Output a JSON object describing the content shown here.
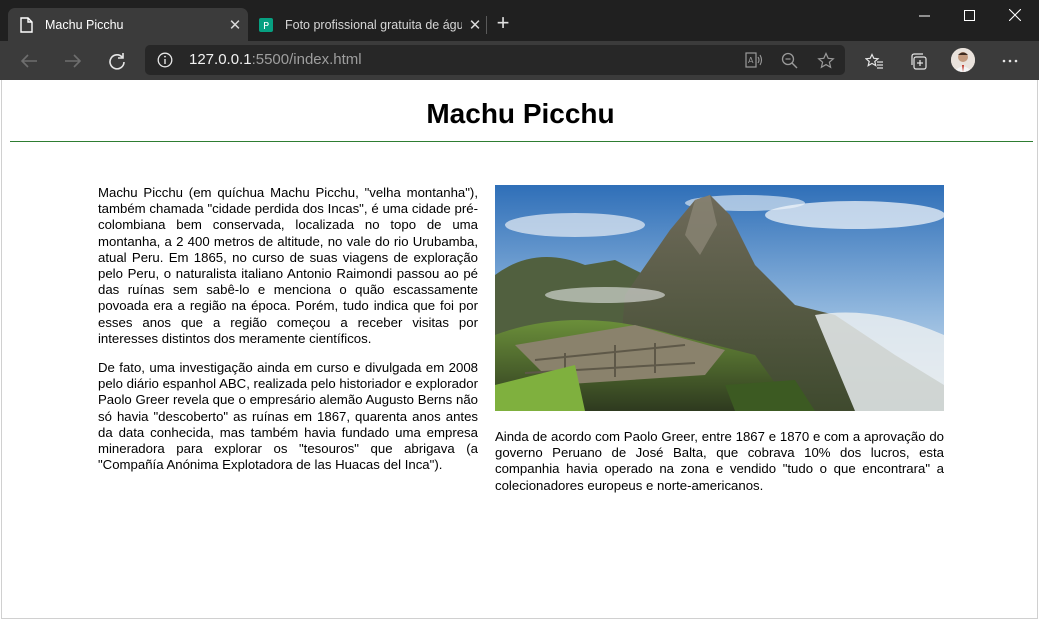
{
  "browser": {
    "tabs": [
      {
        "title": "Machu Picchu",
        "favicon": "page-icon",
        "active": true
      },
      {
        "title": "Foto profissional gratuita de águ",
        "favicon": "pexels-icon",
        "active": false
      }
    ],
    "address": {
      "host": "127.0.0.1",
      "rest": ":5500/index.html"
    },
    "accent": "#3b3b3b"
  },
  "page": {
    "heading": "Machu Picchu",
    "paragraphs_left": [
      "Machu Picchu (em quíchua Machu Picchu, \"velha montanha\"), também chamada \"cidade perdida dos Incas\", é uma cidade pré-colombiana bem conservada, localizada no topo de uma montanha, a 2 400 metros de altitude, no vale do rio Urubamba, atual Peru. Em 1865, no curso de suas viagens de exploração pelo Peru, o naturalista italiano Antonio Raimondi passou ao pé das ruínas sem sabê-lo e menciona o quão escassamente povoada era a região na época. Porém, tudo indica que foi por esses anos que a região começou a receber visitas por interesses distintos dos meramente científicos.",
      "De fato, uma investigação ainda em curso e divulgada em 2008 pelo diário espanhol ABC, realizada pelo historiador e explorador Paolo Greer revela que o empresário alemão Augusto Berns não só havia \"descoberto\" as ruínas em 1867, quarenta anos antes da data conhecida, mas também havia fundado uma empresa mineradora para explorar os \"tesouros\" que abrigava (a \"Compañía Anónima Explotadora de las Huacas del Inca\")."
    ],
    "paragraph_right": "Ainda de acordo com Paolo Greer, entre 1867 e 1870 e com a aprovação do governo Peruano de José Balta, que cobrava 10% dos lucros, esta companhia havia operado na zona e vendido \"tudo o que encontrara\" a colecionadores europeus e norte-americanos.",
    "heading_rule_color": "#2e7d32"
  }
}
